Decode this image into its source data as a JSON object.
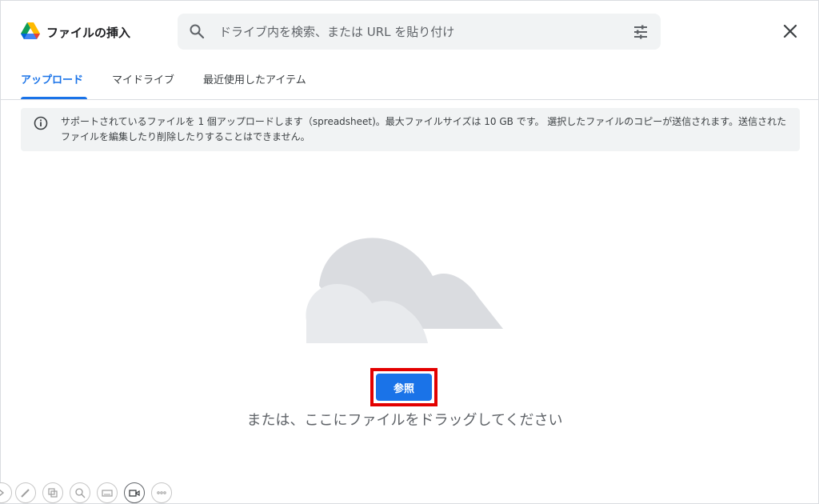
{
  "dialog": {
    "title": "ファイルの挿入",
    "close_icon": "close-icon"
  },
  "search": {
    "placeholder": "ドライブ内を検索、または URL を貼り付け",
    "value": "",
    "search_icon": "search-icon",
    "options_icon": "tune-icon"
  },
  "tabs": [
    {
      "label": "アップロード",
      "active": true
    },
    {
      "label": "マイドライブ",
      "active": false
    },
    {
      "label": "最近使用したアイテム",
      "active": false
    }
  ],
  "info": {
    "icon": "info-icon",
    "text": "サポートされているファイルを 1 個アップロードします（spreadsheet)。最大ファイルサイズは 10 GB です。 選択したファイルのコピーが送信されます。送信されたファイルを編集したり削除したりすることはできません。"
  },
  "upload": {
    "illustration": "cloud-illustration",
    "browse_label": "参照",
    "drag_hint": "または、ここにファイルをドラッグしてください"
  },
  "toolbar": {
    "icons": [
      "arrow-icon",
      "pen-icon",
      "copy-icon",
      "zoom-icon",
      "keyboard-icon",
      "video-icon",
      "more-icon"
    ]
  },
  "colors": {
    "accent": "#1a73e8",
    "highlight": "#e30000",
    "banner_bg": "#f1f3f4",
    "cloud_back": "#dadce0",
    "cloud_front": "#e8eaed"
  }
}
